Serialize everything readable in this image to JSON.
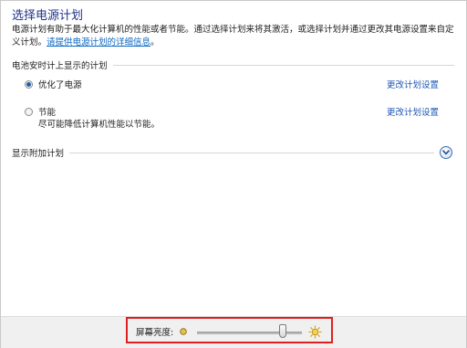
{
  "page": {
    "title": "选择电源计划",
    "description": "电源计划有助于最大化计算机的性能或者节能。通过选择计划来将其激活，或选择计划并通过更改其电源设置来自定义计划。",
    "details_link": "请提供电源计划的详细信息"
  },
  "battery_meter_section": {
    "label": "电池安时计上显示的计划",
    "plans": [
      {
        "name": "优化了电源",
        "selected": true,
        "change_label": "更改计划设置",
        "description": ""
      },
      {
        "name": "节能",
        "selected": false,
        "change_label": "更改计划设置",
        "description": "尽可能降低计算机性能以节能。"
      }
    ]
  },
  "additional_plans": {
    "label": "显示附加计划",
    "icon": "chevron-down-icon"
  },
  "brightness": {
    "label": "屏幕亮度:",
    "level_fraction": 0.84,
    "dim_icon": "sun-dim-icon",
    "bright_icon": "sun-bright-icon"
  },
  "colors": {
    "title": "#1e3287",
    "link": "#1e57b4",
    "highlight": "#e02020",
    "radio_selected": "#1f5ea8"
  }
}
